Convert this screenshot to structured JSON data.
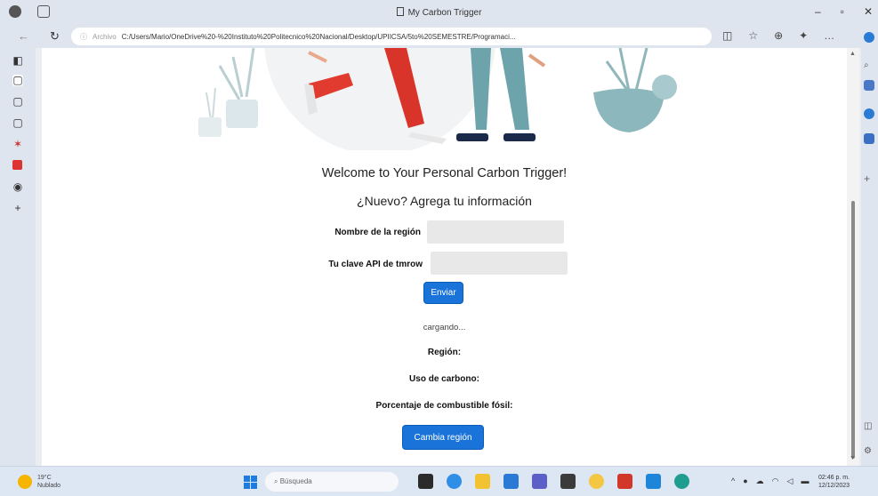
{
  "window": {
    "tab_title": "My Carbon Trigger"
  },
  "address_bar": {
    "prefix": "Archivo",
    "url": "C:/Users/Mario/OneDrive%20-%20Instituto%20Politecnico%20Nacional/Desktop/UPIICSA/5to%20SEMESTRE/Programaci..."
  },
  "page": {
    "welcome": "Welcome to Your Personal Carbon Trigger!",
    "subtitle": "¿Nuevo? Agrega tu información",
    "form": {
      "region_label": "Nombre de la región",
      "region_value": "",
      "api_label": "Tu clave API de tmrow",
      "api_value": "",
      "submit_label": "Enviar"
    },
    "loading_text": "cargando...",
    "results": {
      "region_label": "Región:",
      "carbon_label": "Uso de carbono:",
      "fossil_label": "Porcentaje de combustible fósil:"
    },
    "change_region_label": "Cambia región"
  },
  "taskbar": {
    "weather_temp": "19°C",
    "weather_desc": "Nublado",
    "search_placeholder": "Búsqueda",
    "time": "02:46 p. m.",
    "date": "12/12/2023"
  },
  "colors": {
    "accent": "#1a73d8",
    "chrome": "#dfe5ee",
    "field_bg": "#e8e8e8"
  }
}
